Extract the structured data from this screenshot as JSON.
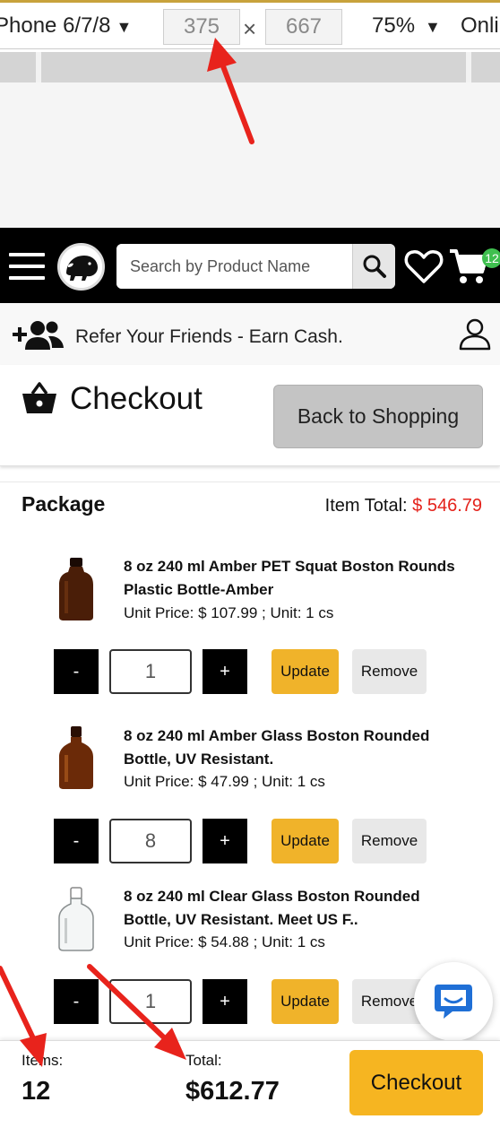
{
  "devtools": {
    "device": "Phone 6/7/8",
    "width": "375",
    "height": "667",
    "zoom": "75%",
    "network": "Onli"
  },
  "header": {
    "search_placeholder": "Search by Product Name",
    "cart_count": "12"
  },
  "refer": {
    "text": "Refer Your Friends - Earn Cash."
  },
  "checkout_header": {
    "title": "Checkout",
    "back_label": "Back to Shopping"
  },
  "package": {
    "title": "Package",
    "item_total_label": "Item Total:",
    "item_total_value": "$ 546.79",
    "items": [
      {
        "name": "8 oz 240 ml Amber PET Squat Boston Rounds Plastic Bottle-Amber",
        "price_line": "Unit Price: $ 107.99 ;  Unit: 1 cs",
        "qty": "1",
        "bottle": "amber-plastic"
      },
      {
        "name": "8 oz 240 ml Amber Glass Boston Rounded Bottle, UV Resistant.",
        "price_line": "Unit Price: $ 47.99 ;  Unit: 1 cs",
        "qty": "8",
        "bottle": "amber-glass"
      },
      {
        "name": "8 oz 240 ml Clear Glass Boston Rounded Bottle, UV Resistant. Meet US F..",
        "price_line": "Unit Price: $ 54.88 ;  Unit: 1 cs",
        "qty": "1",
        "bottle": "clear-glass"
      }
    ],
    "minus_label": "-",
    "plus_label": "+",
    "update_label": "Update",
    "remove_label": "Remove"
  },
  "summary": {
    "items_label": "Items:",
    "items_value": "12",
    "total_label": "Total:",
    "total_value": "$612.77",
    "checkout_label": "Checkout"
  },
  "colors": {
    "accent_yellow": "#f0b32a",
    "price_red": "#e4221b",
    "cart_badge": "#3fbf4f",
    "annotation_arrow": "#e8231c"
  }
}
